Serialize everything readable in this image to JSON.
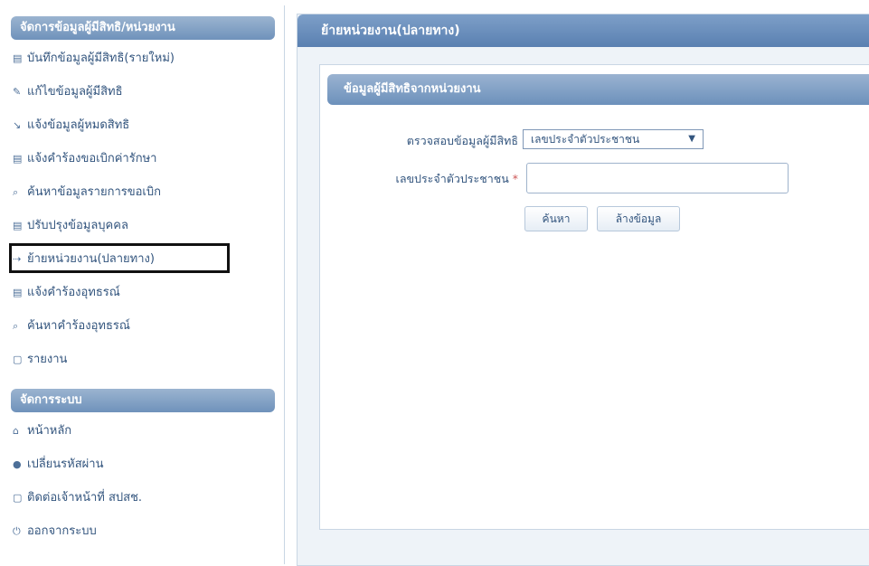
{
  "sidebar": {
    "section1_title": "จัดการข้อมูลผู้มีสิทธิ/หน่วยงาน",
    "items": [
      {
        "icon": "▤",
        "label": "บันทึกข้อมูลผู้มีสิทธิ(รายใหม่)"
      },
      {
        "icon": "✎",
        "label": "แก้ไขข้อมูลผู้มีสิทธิ"
      },
      {
        "icon": "↘",
        "label": "แจ้งข้อมูลผู้หมดสิทธิ"
      },
      {
        "icon": "▤",
        "label": "แจ้งคำร้องขอเบิกค่ารักษา"
      },
      {
        "icon": "⌕",
        "label": "ค้นหาข้อมูลรายการขอเบิก"
      },
      {
        "icon": "▤",
        "label": "ปรับปรุงข้อมูลบุคคล"
      },
      {
        "icon": "⇢",
        "label": "ย้ายหน่วยงาน(ปลายทาง)"
      },
      {
        "icon": "▤",
        "label": "แจ้งคำร้องอุทธรณ์"
      },
      {
        "icon": "⌕",
        "label": "ค้นหาคำร้องอุทธรณ์"
      },
      {
        "icon": "▢",
        "label": "รายงาน"
      }
    ],
    "section2_title": "จัดการระบบ",
    "system_items": [
      {
        "icon": "⌂",
        "label": "หน้าหลัก"
      },
      {
        "icon": "●",
        "label": "เปลี่ยนรหัสผ่าน"
      },
      {
        "icon": "▢",
        "label": "ติดต่อเจ้าหน้าที่ สปสช."
      },
      {
        "icon": "⏻",
        "label": "ออกจากระบบ"
      }
    ]
  },
  "main": {
    "title": "ย้ายหน่วยงาน(ปลายทาง)",
    "card_title": "ข้อมูลผู้มีสิทธิจากหน่วยงาน",
    "check_label": "ตรวจสอบข้อมูลผู้มีสิทธิ",
    "check_select_value": "เลขประจำตัวประชาชน",
    "select_arrow": "▼",
    "id_label": "เลขประจำตัวประชาชน",
    "required_mark": "*",
    "id_value": "",
    "search_button": "ค้นหา",
    "clear_button": "ล้างข้อมูล"
  }
}
